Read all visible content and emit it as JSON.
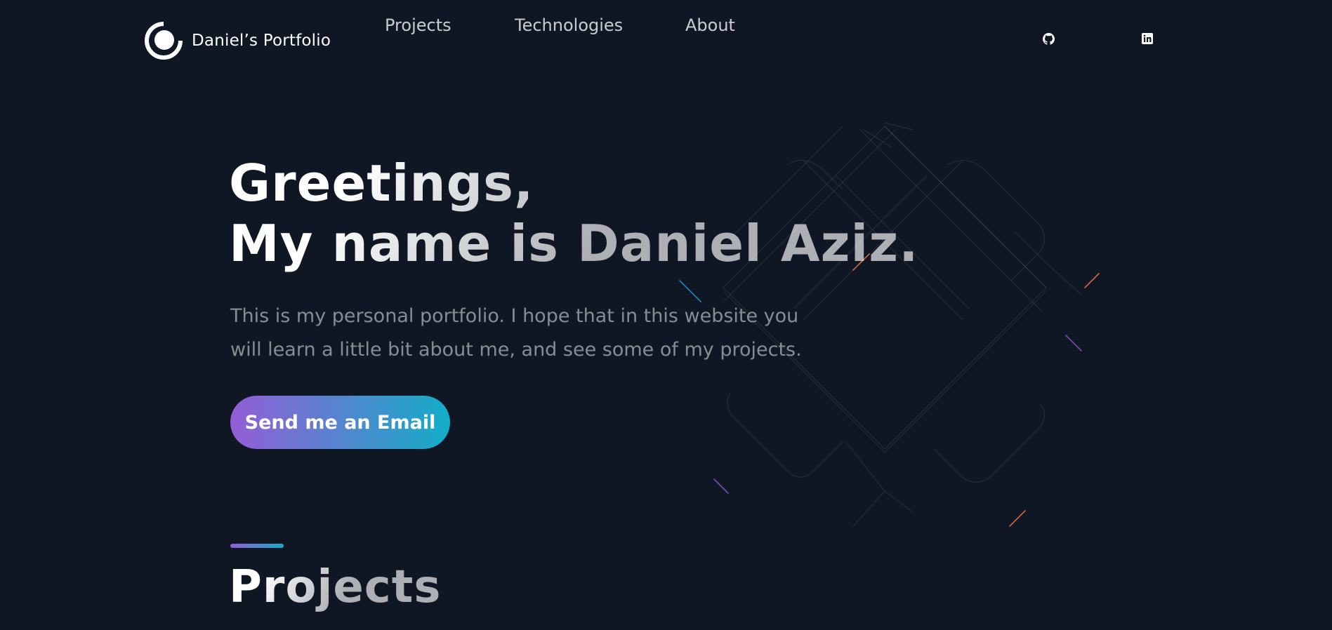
{
  "header": {
    "brand_name": "Daniel’s Portfolio",
    "logo_icon": "portfolio-ring-logo-icon",
    "nav": {
      "projects": "Projects",
      "technologies": "Technologies",
      "about": "About"
    },
    "social": {
      "github_icon": "github-icon",
      "linkedin_icon": "linkedin-icon"
    }
  },
  "hero": {
    "title_line1": "Greetings,",
    "title_line2": "My name is Daniel Aziz.",
    "description": "This is my personal portfolio. I hope that in this website you will learn a little bit about me, and see some of my projects.",
    "button_label": "Send me an Email"
  },
  "projects_section": {
    "title": "Projects"
  },
  "colors": {
    "background": "#0f1624",
    "accent_purple": "#945dd6",
    "accent_cyan": "#13adc7"
  }
}
